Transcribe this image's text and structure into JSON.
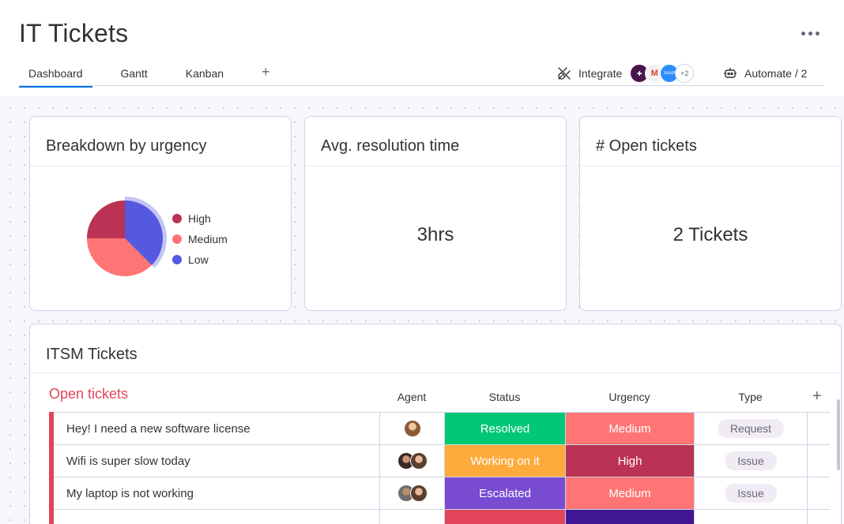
{
  "header": {
    "title": "IT Tickets",
    "tabs": [
      {
        "label": "Dashboard"
      },
      {
        "label": "Gantt"
      },
      {
        "label": "Kanban"
      }
    ],
    "add_tab": "+",
    "integrate_label": "Integrate",
    "integrate_apps": [
      "slack",
      "gmail",
      "zoom"
    ],
    "integrate_more": "+2",
    "automate_label": "Automate / 2"
  },
  "widgets": {
    "urgency": {
      "title": "Breakdown by urgency",
      "chart_data": {
        "type": "pie",
        "title": "Breakdown by urgency",
        "categories": [
          "High",
          "Medium",
          "Low"
        ],
        "values": [
          25,
          37.5,
          37.5
        ],
        "colors": [
          "#bb3354",
          "#ff7575",
          "#5559df"
        ],
        "highlighted": "Low",
        "legend": "right"
      }
    },
    "resolution": {
      "title": "Avg. resolution time",
      "value": "3hrs"
    },
    "open": {
      "title": "# Open tickets",
      "value": "2 Tickets"
    }
  },
  "board": {
    "title": "ITSM Tickets",
    "group": "Open tickets",
    "columns": {
      "agent": "Agent",
      "status": "Status",
      "urgency": "Urgency",
      "type": "Type"
    },
    "add_column": "+",
    "rows": [
      {
        "name": "Hey! I need a new software license",
        "status": "Resolved",
        "status_color": "#00c875",
        "urgency": "Medium",
        "urgency_color": "#ff7575",
        "type": "Request"
      },
      {
        "name": "Wifi is super slow today",
        "status": "Working on it",
        "status_color": "#fdab3d",
        "urgency": "High",
        "urgency_color": "#bb3354",
        "type": "Issue"
      },
      {
        "name": "My laptop is not working",
        "status": "Escalated",
        "status_color": "#784bd1",
        "urgency": "Medium",
        "urgency_color": "#ff7575",
        "type": "Issue"
      },
      {
        "name": "",
        "status": "",
        "status_color": "#e2445c",
        "urgency": "",
        "urgency_color": "#401694",
        "type": ""
      }
    ]
  }
}
